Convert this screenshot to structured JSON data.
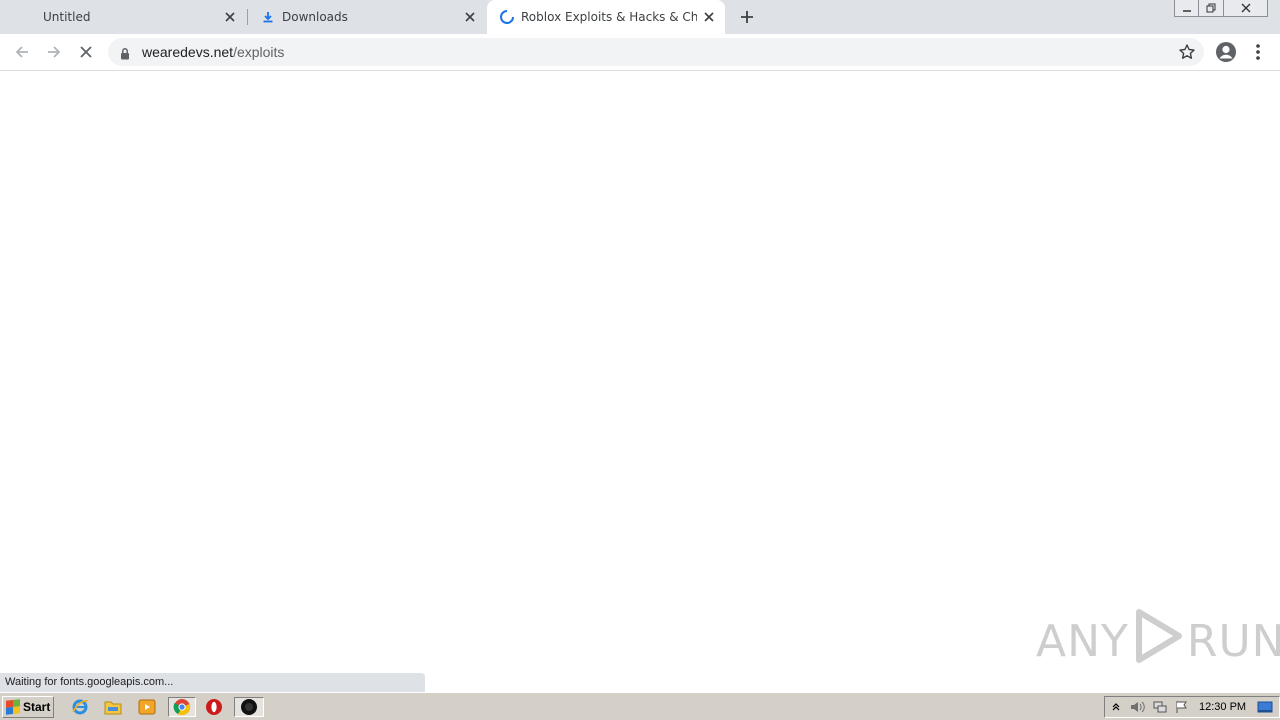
{
  "browser": {
    "tabs": [
      {
        "title": "Untitled",
        "active": false,
        "icon": "none"
      },
      {
        "title": "Downloads",
        "active": false,
        "icon": "download-icon"
      },
      {
        "title": "Roblox Exploits & Hacks & Cheats - W",
        "active": true,
        "icon": "loading-spinner-icon"
      }
    ],
    "address": {
      "domain": "wearedevs.net",
      "path": "/exploits"
    },
    "status_text": "Waiting for fonts.googleapis.com...",
    "loading": true
  },
  "watermark": {
    "left": "ANY",
    "right": "RUN"
  },
  "taskbar": {
    "start_label": "Start",
    "pinned": [
      "internet-explorer-icon",
      "file-explorer-icon",
      "media-player-icon",
      "chrome-icon",
      "opera-icon",
      "app-icon"
    ],
    "clock": "12:30 PM"
  },
  "colors": {
    "tabstrip": "#dee1e6",
    "accent_blue": "#1a73e8",
    "taskbar": "#d4d0c8"
  }
}
